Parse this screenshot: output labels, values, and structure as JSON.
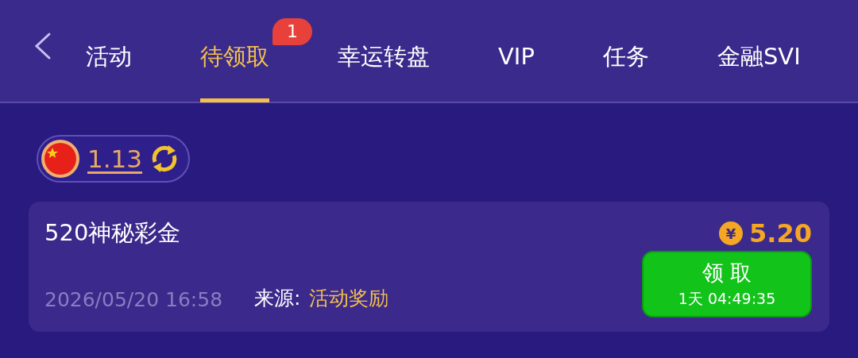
{
  "tabs": [
    {
      "label": "活动",
      "selected": false
    },
    {
      "label": "待领取",
      "selected": true,
      "badge": "1"
    },
    {
      "label": "幸运转盘",
      "selected": false
    },
    {
      "label": "VIP",
      "selected": false
    },
    {
      "label": "任务",
      "selected": false
    },
    {
      "label": "金融SVI",
      "selected": false
    }
  ],
  "balance": {
    "amount": "1.13"
  },
  "rewards": [
    {
      "title": "520神秘彩金",
      "currency": "¥",
      "amount": "5.20",
      "date": "2026/05/20 16:58",
      "source_label": "来源:",
      "source": "活动奖励",
      "button": "领 取",
      "countdown": "1天 04:49:35"
    }
  ]
}
